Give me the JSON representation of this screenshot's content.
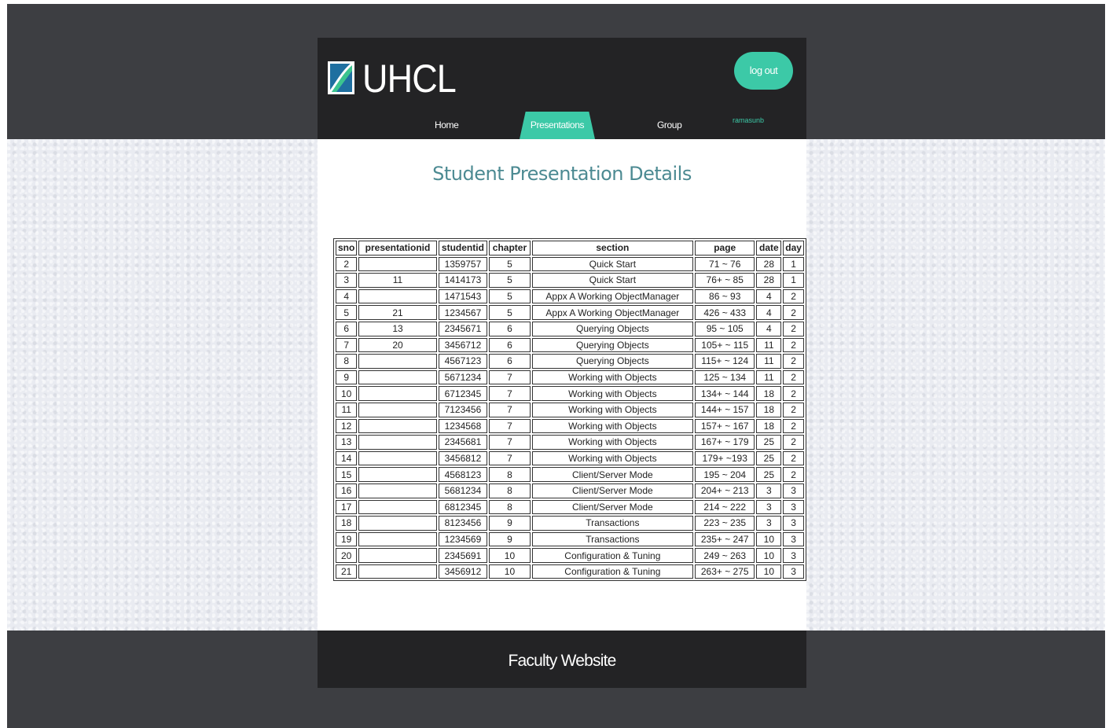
{
  "header": {
    "logo_text": "UHCL",
    "logout_label": "log out",
    "username": "ramasunb",
    "nav": [
      {
        "label": "Home"
      },
      {
        "label": "Presentations"
      },
      {
        "label": "Group"
      }
    ],
    "active_nav": "Presentations"
  },
  "main": {
    "title": "Student Presentation Details",
    "table": {
      "columns": [
        "sno",
        "presentationid",
        "studentid",
        "chapter",
        "section",
        "page",
        "date",
        "day"
      ],
      "rows": [
        [
          "2",
          "",
          "1359757",
          "5",
          "Quick Start",
          "71 ~ 76",
          "28",
          "1"
        ],
        [
          "3",
          "11",
          "1414173",
          "5",
          "Quick Start",
          "76+ ~ 85",
          "28",
          "1"
        ],
        [
          "4",
          "",
          "1471543",
          "5",
          "Appx A Working ObjectManager",
          "86 ~ 93",
          "4",
          "2"
        ],
        [
          "5",
          "21",
          "1234567",
          "5",
          "Appx A Working ObjectManager",
          "426 ~ 433",
          "4",
          "2"
        ],
        [
          "6",
          "13",
          "2345671",
          "6",
          "Querying Objects",
          "95 ~ 105",
          "4",
          "2"
        ],
        [
          "7",
          "20",
          "3456712",
          "6",
          "Querying Objects",
          "105+ ~ 115",
          "11",
          "2"
        ],
        [
          "8",
          "",
          "4567123",
          "6",
          "Querying Objects",
          "115+ ~ 124",
          "11",
          "2"
        ],
        [
          "9",
          "",
          "5671234",
          "7",
          "Working with Objects",
          "125 ~ 134",
          "11",
          "2"
        ],
        [
          "10",
          "",
          "6712345",
          "7",
          "Working with Objects",
          "134+ ~ 144",
          "18",
          "2"
        ],
        [
          "11",
          "",
          "7123456",
          "7",
          "Working with Objects",
          "144+ ~ 157",
          "18",
          "2"
        ],
        [
          "12",
          "",
          "1234568",
          "7",
          "Working with Objects",
          "157+ ~ 167",
          "18",
          "2"
        ],
        [
          "13",
          "",
          "2345681",
          "7",
          "Working with Objects",
          "167+ ~ 179",
          "25",
          "2"
        ],
        [
          "14",
          "",
          "3456812",
          "7",
          "Working with Objects",
          "179+ ~193",
          "25",
          "2"
        ],
        [
          "15",
          "",
          "4568123",
          "8",
          "Client/Server Mode",
          "195 ~ 204",
          "25",
          "2"
        ],
        [
          "16",
          "",
          "5681234",
          "8",
          "Client/Server Mode",
          "204+ ~ 213",
          "3",
          "3"
        ],
        [
          "17",
          "",
          "6812345",
          "8",
          "Client/Server Mode",
          "214 ~ 222",
          "3",
          "3"
        ],
        [
          "18",
          "",
          "8123456",
          "9",
          "Transactions",
          "223 ~ 235",
          "3",
          "3"
        ],
        [
          "19",
          "",
          "1234569",
          "9",
          "Transactions",
          "235+ ~ 247",
          "10",
          "3"
        ],
        [
          "20",
          "",
          "2345691",
          "10",
          "Configuration & Tuning",
          "249 ~ 263",
          "10",
          "3"
        ],
        [
          "21",
          "",
          "3456912",
          "10",
          "Configuration & Tuning",
          "263+ ~ 275",
          "10",
          "3"
        ]
      ]
    }
  },
  "footer": {
    "text": "Faculty Website"
  },
  "colors": {
    "accent": "#3cc9a7",
    "header_bg": "#232325",
    "outer_bg": "#3d3e42",
    "title": "#4c8a92"
  }
}
